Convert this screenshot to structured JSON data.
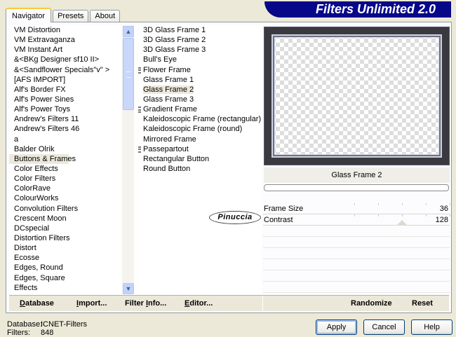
{
  "tabs": [
    {
      "label": "Navigator",
      "active": true
    },
    {
      "label": "Presets",
      "active": false
    },
    {
      "label": "About",
      "active": false
    }
  ],
  "banner": "Filters Unlimited 2.0",
  "categories": [
    "VM Distortion",
    "VM Extravaganza",
    "VM Instant Art",
    "&<BKg Designer sf10 II>",
    "&<Sandflower Specials\"v\" >",
    "[AFS IMPORT]",
    "Alf's Border FX",
    "Alf's Power Sines",
    "Alf's Power Toys",
    "Andrew's Filters 11",
    "Andrew's Filters 46",
    "a",
    "Balder Olrik",
    "Buttons & Frames",
    "Color Effects",
    "Color Filters",
    "ColorRave",
    "ColourWorks",
    "Convolution Filters",
    "Crescent Moon",
    "DCspecial",
    "Distortion Filters",
    "Distort",
    "Ecosse",
    "Edges, Round",
    "Edges, Square",
    "Effects"
  ],
  "selected_category": "Buttons & Frames",
  "filters": [
    {
      "label": "3D Glass Frame 1",
      "group": false
    },
    {
      "label": "3D Glass Frame 2",
      "group": false
    },
    {
      "label": "3D Glass Frame 3",
      "group": false
    },
    {
      "label": "Bull's Eye",
      "group": false
    },
    {
      "label": "Flower Frame",
      "group": true
    },
    {
      "label": "Glass Frame 1",
      "group": false
    },
    {
      "label": "Glass Frame 2",
      "group": false
    },
    {
      "label": "Glass Frame 3",
      "group": false
    },
    {
      "label": "Gradient Frame",
      "group": true
    },
    {
      "label": "Kaleidoscopic Frame (rectangular)",
      "group": false
    },
    {
      "label": "Kaleidoscopic Frame (round)",
      "group": false
    },
    {
      "label": "Mirrored Frame",
      "group": false
    },
    {
      "label": "Passepartout",
      "group": true
    },
    {
      "label": "Rectangular Button",
      "group": false
    },
    {
      "label": "Round Button",
      "group": false
    }
  ],
  "selected_filter": "Glass Frame 2",
  "preview_filter_name": "Glass Frame 2",
  "sliders": [
    {
      "label": "Frame Size",
      "value": "36",
      "max": 255
    },
    {
      "label": "Contrast",
      "value": "128",
      "max": 255
    }
  ],
  "bottom_buttons": {
    "database": {
      "u": "D",
      "rest": "atabase"
    },
    "import": {
      "u": "I",
      "rest": "mport..."
    },
    "filter_info_pre": "Filter ",
    "filter_info_u": "I",
    "filter_info_post": "nfo...",
    "editor": {
      "u": "E",
      "rest": "ditor..."
    },
    "randomize": "Randomize",
    "reset": "Reset"
  },
  "logo_text": "Pinuccia",
  "status": {
    "database_label": "Database:",
    "database_value": "ICNET-Filters",
    "filters_label": "Filters:",
    "filters_value": "848"
  },
  "dialog_buttons": {
    "apply": "Apply",
    "cancel": "Cancel",
    "help": "Help"
  },
  "colors": {
    "banner": "#07078a",
    "selection": "#ede8dc",
    "dialog": "#ece9d8"
  }
}
